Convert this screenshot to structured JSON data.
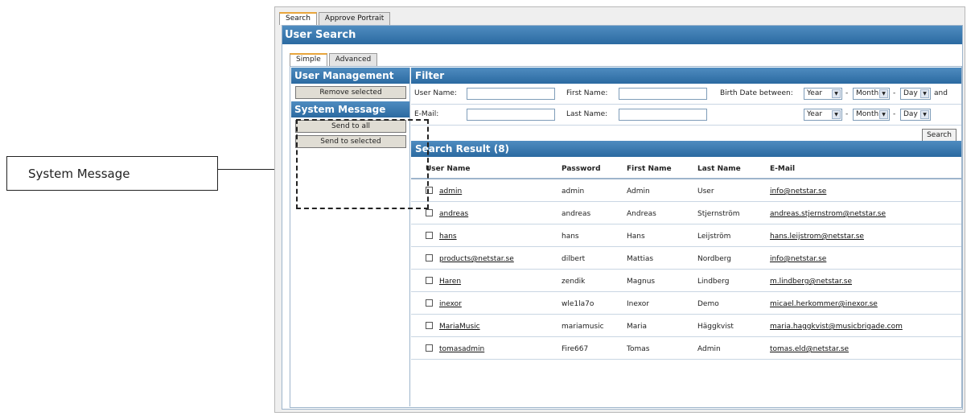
{
  "callout": {
    "label": "System Message"
  },
  "outer_tabs": [
    {
      "label": "Search"
    },
    {
      "label": "Approve Portrait"
    }
  ],
  "panel": {
    "title": "User Search"
  },
  "inner_tabs": [
    {
      "label": "Simple"
    },
    {
      "label": "Advanced"
    }
  ],
  "sidebar": {
    "user_management": {
      "title": "User Management",
      "remove_selected": "Remove selected"
    },
    "system_message": {
      "title": "System Message",
      "send_to_all": "Send to all",
      "send_to_selected": "Send to selected"
    }
  },
  "filter": {
    "title": "Filter",
    "user_name_label": "User Name:",
    "first_name_label": "First Name:",
    "email_label": "E-Mail:",
    "last_name_label": "Last Name:",
    "birth_date_label": "Birth Date between:",
    "year": "Year",
    "month": "Month",
    "day": "Day",
    "dash": "-",
    "and": "and",
    "search_button": "Search"
  },
  "results": {
    "title": "Search Result (8)",
    "columns": [
      "User Name",
      "Password",
      "First Name",
      "Last Name",
      "E-Mail"
    ],
    "rows": [
      {
        "user": "admin",
        "password": "admin",
        "first": "Admin",
        "last": "User",
        "email": "info@netstar.se"
      },
      {
        "user": "andreas",
        "password": "andreas",
        "first": "Andreas",
        "last": "Stjernström",
        "email": "andreas.stjernstrom@netstar.se"
      },
      {
        "user": "hans",
        "password": "hans",
        "first": "Hans",
        "last": "Leijström",
        "email": "hans.leijstrom@netstar.se"
      },
      {
        "user": "products@netstar.se",
        "password": "dilbert",
        "first": "Mattias",
        "last": "Nordberg",
        "email": "info@netstar.se"
      },
      {
        "user": "Haren",
        "password": "zendik",
        "first": "Magnus",
        "last": "Lindberg",
        "email": "m.lindberg@netstar.se"
      },
      {
        "user": "inexor",
        "password": "wle1la7o",
        "first": "Inexor",
        "last": "Demo",
        "email": "micael.herkommer@inexor.se"
      },
      {
        "user": "MariaMusic",
        "password": "mariamusic",
        "first": "Maria",
        "last": "Häggkvist",
        "email": "maria.haggkvist@musicbrigade.com"
      },
      {
        "user": "tomasadmin",
        "password": "Fire667",
        "first": "Tomas",
        "last": "Admin",
        "email": "tomas.eld@netstar.se"
      }
    ]
  }
}
